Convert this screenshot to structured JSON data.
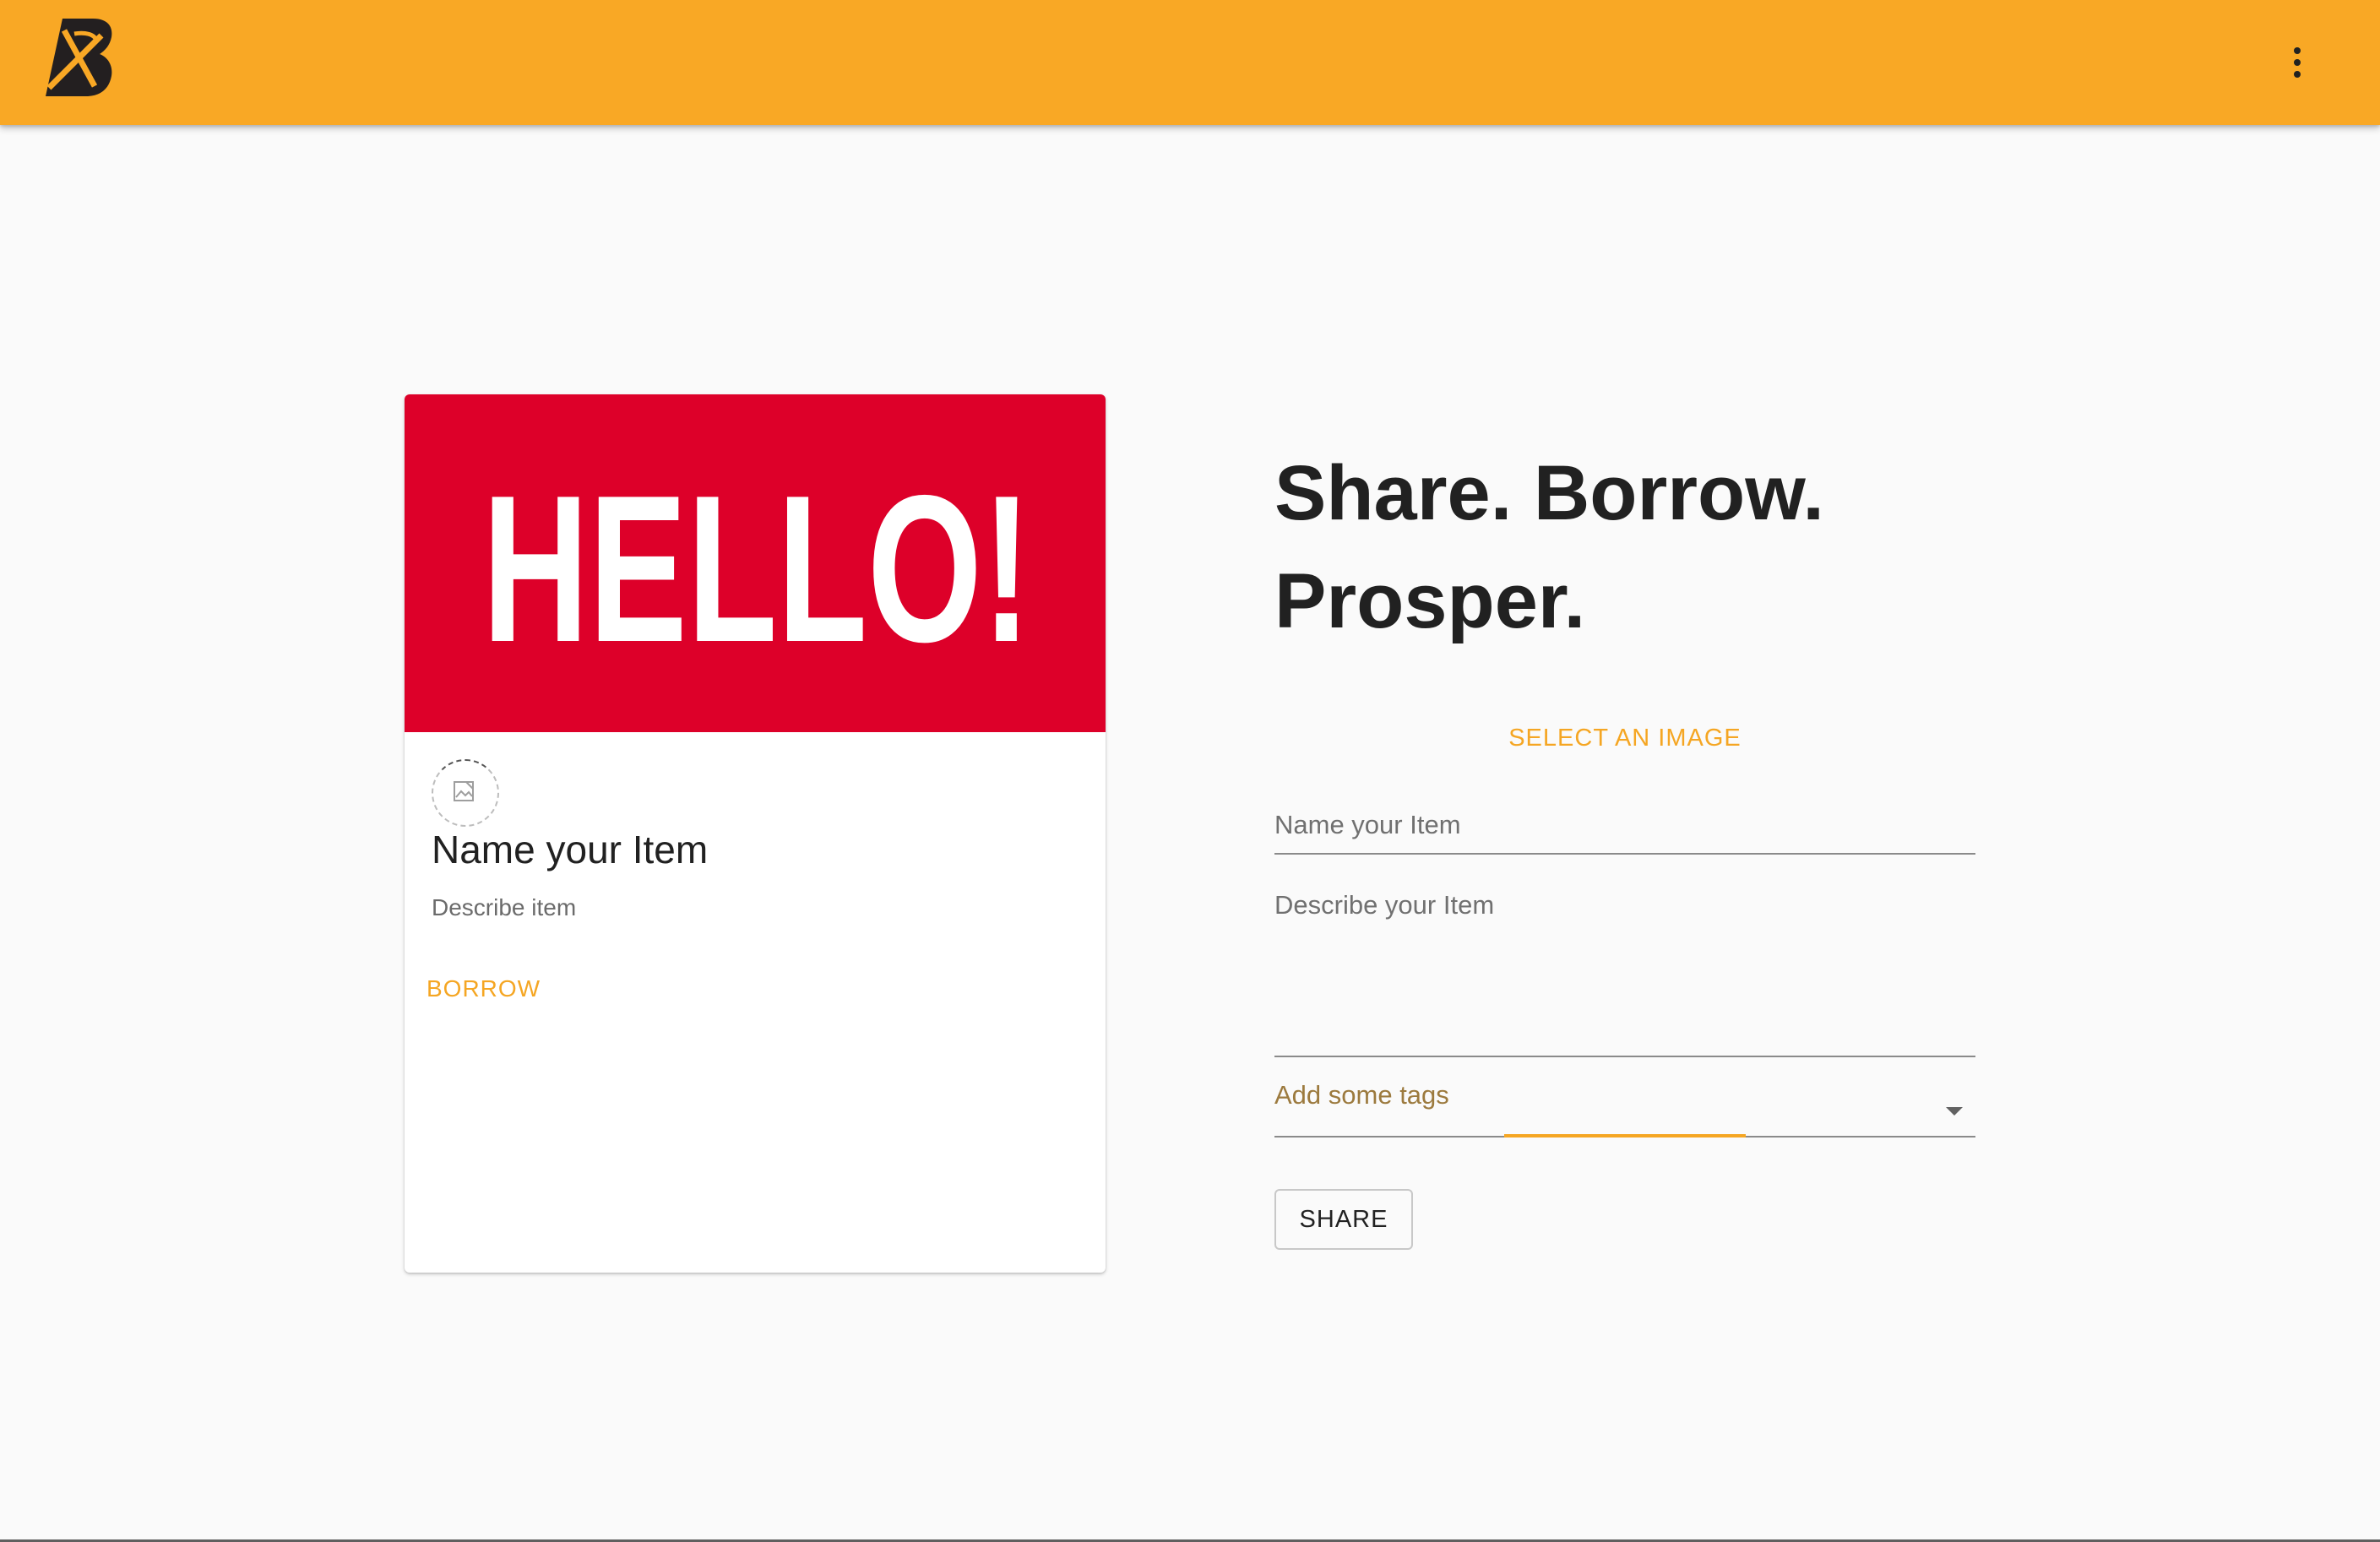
{
  "appbar": {
    "background": "#f9a825",
    "logo_icon": "boomtown-b-logo-icon",
    "menu_icon": "more-vert-icon"
  },
  "preview_card": {
    "media_text": "HELLO!",
    "media_color": "#dd0029",
    "avatar_icon": "broken-image-icon",
    "title": "Name your Item",
    "description": "Describe item",
    "borrow_label": "BORROW"
  },
  "form": {
    "headline_line1": "Share. Borrow.",
    "headline_line2": "Prosper.",
    "select_image_label": "SELECT AN IMAGE",
    "name_label": "Name your Item",
    "description_label": "Describe your Item",
    "tags_label": "Add some tags",
    "share_label": "SHARE",
    "accent_color": "#f5a623"
  }
}
